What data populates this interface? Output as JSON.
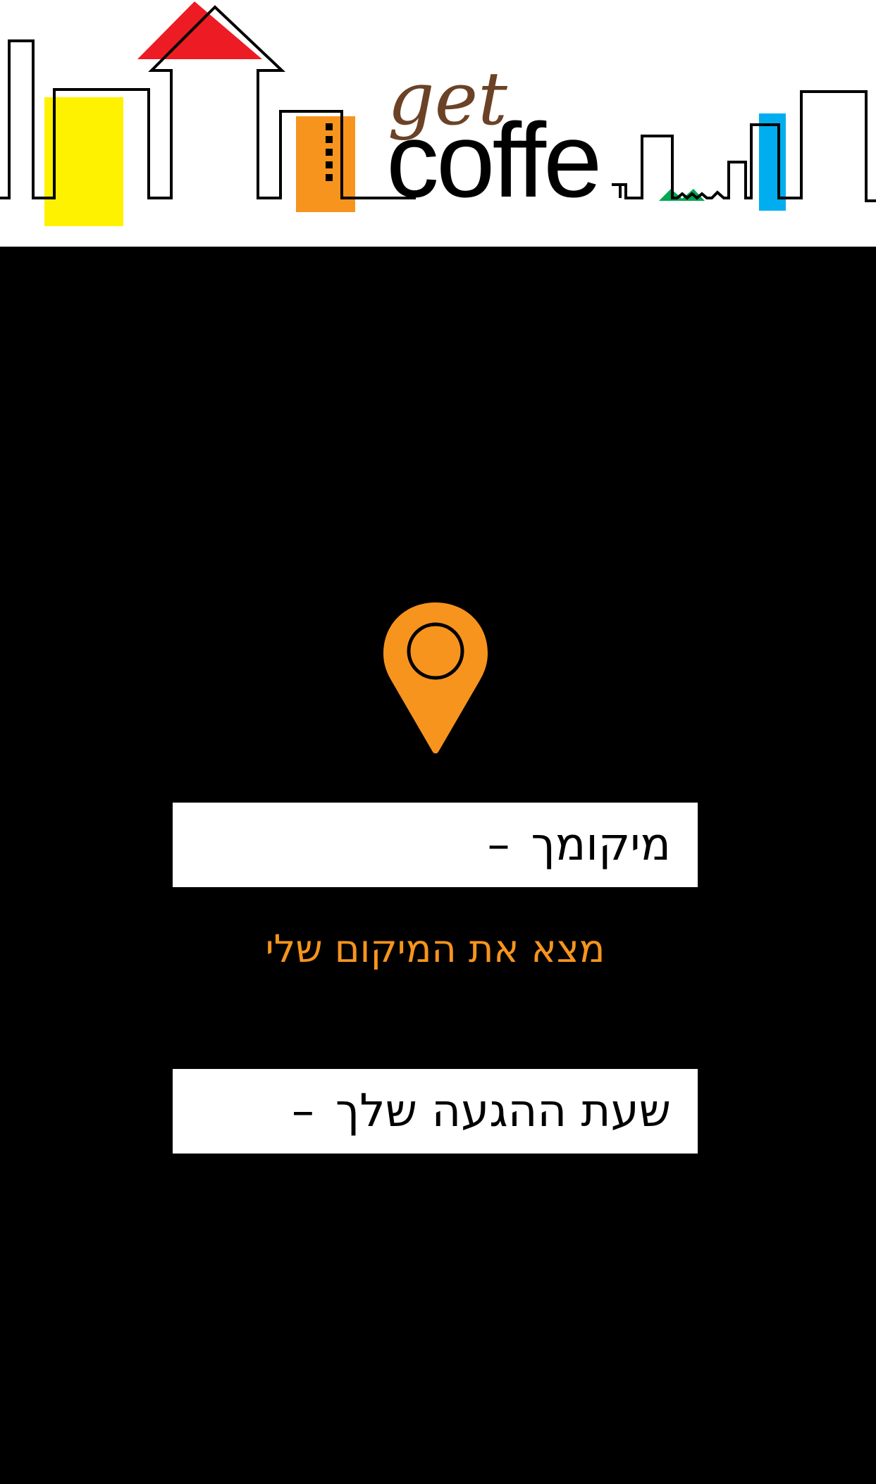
{
  "header": {
    "logo_small": "get",
    "logo_large": "coffe"
  },
  "location": {
    "label": "מיקומך",
    "value": "–"
  },
  "find_location_link": "מצא את המיקום שלי",
  "arrival": {
    "label": "שעת ההגעה שלך",
    "value": "–"
  },
  "icons": {
    "pin": "map-pin-icon"
  },
  "colors": {
    "accent_orange": "#f7941d",
    "logo_brown": "#6b4226",
    "roof_red": "#ed1c24",
    "yellow": "#fff200",
    "blue": "#00aeef",
    "green": "#00a651",
    "background": "#000000"
  }
}
